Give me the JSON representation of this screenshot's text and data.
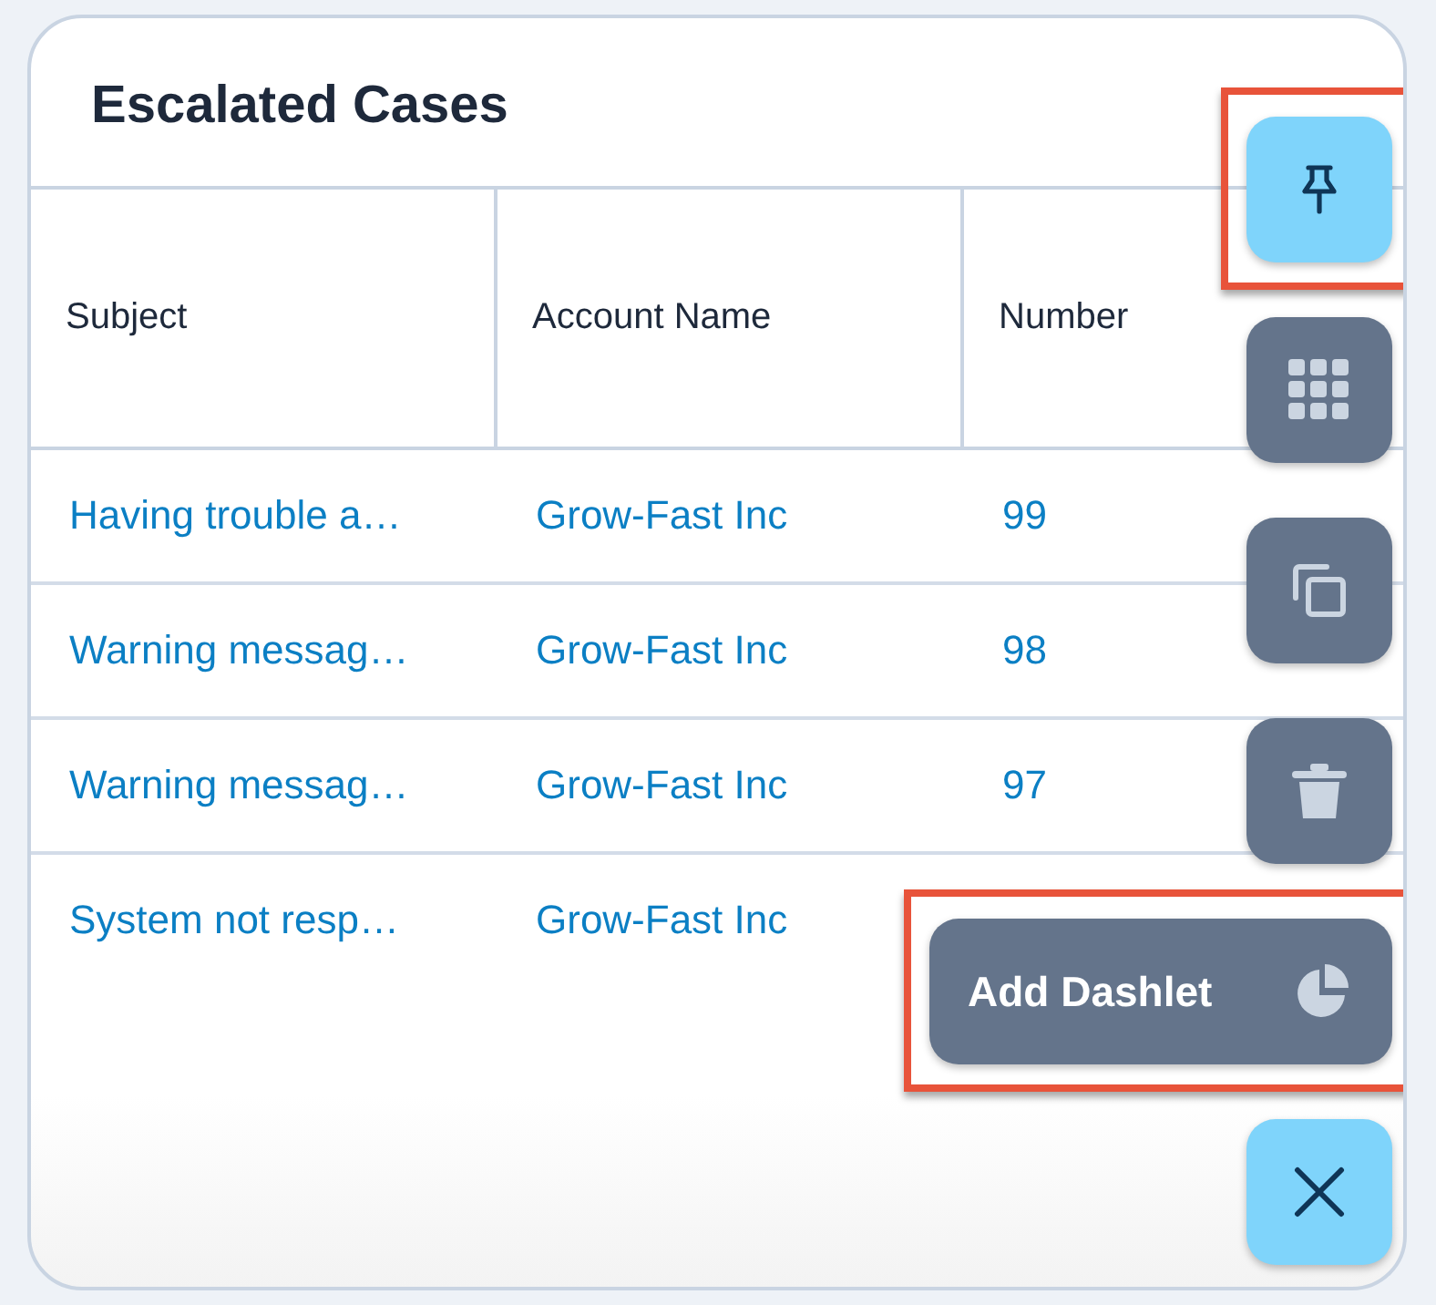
{
  "dashlet": {
    "title": "Escalated Cases"
  },
  "table": {
    "columns": [
      "Subject",
      "Account Name",
      "Number"
    ],
    "rows": [
      {
        "cells": [
          "Having trouble a…",
          "Grow-Fast Inc",
          "99"
        ]
      },
      {
        "cells": [
          "Warning messag…",
          "Grow-Fast Inc",
          "98"
        ]
      },
      {
        "cells": [
          "Warning messag…",
          "Grow-Fast Inc",
          "97"
        ]
      },
      {
        "cells": [
          "System not resp…",
          "Grow-Fast Inc"
        ]
      }
    ]
  },
  "fab_menu": [
    {
      "kind": "pin",
      "color": "#7fd4fb",
      "highlighted": true
    },
    {
      "kind": "grid",
      "color": "#64748b",
      "highlighted": false
    },
    {
      "kind": "copy",
      "color": "#64748b",
      "highlighted": false
    },
    {
      "kind": "trash",
      "color": "#64748b",
      "highlighted": false
    },
    {
      "kind": "chart",
      "label": "Add Dashlet",
      "color": "#64748b",
      "highlighted": true
    },
    {
      "kind": "close",
      "color": "#7fd4fb",
      "highlighted": false
    }
  ]
}
